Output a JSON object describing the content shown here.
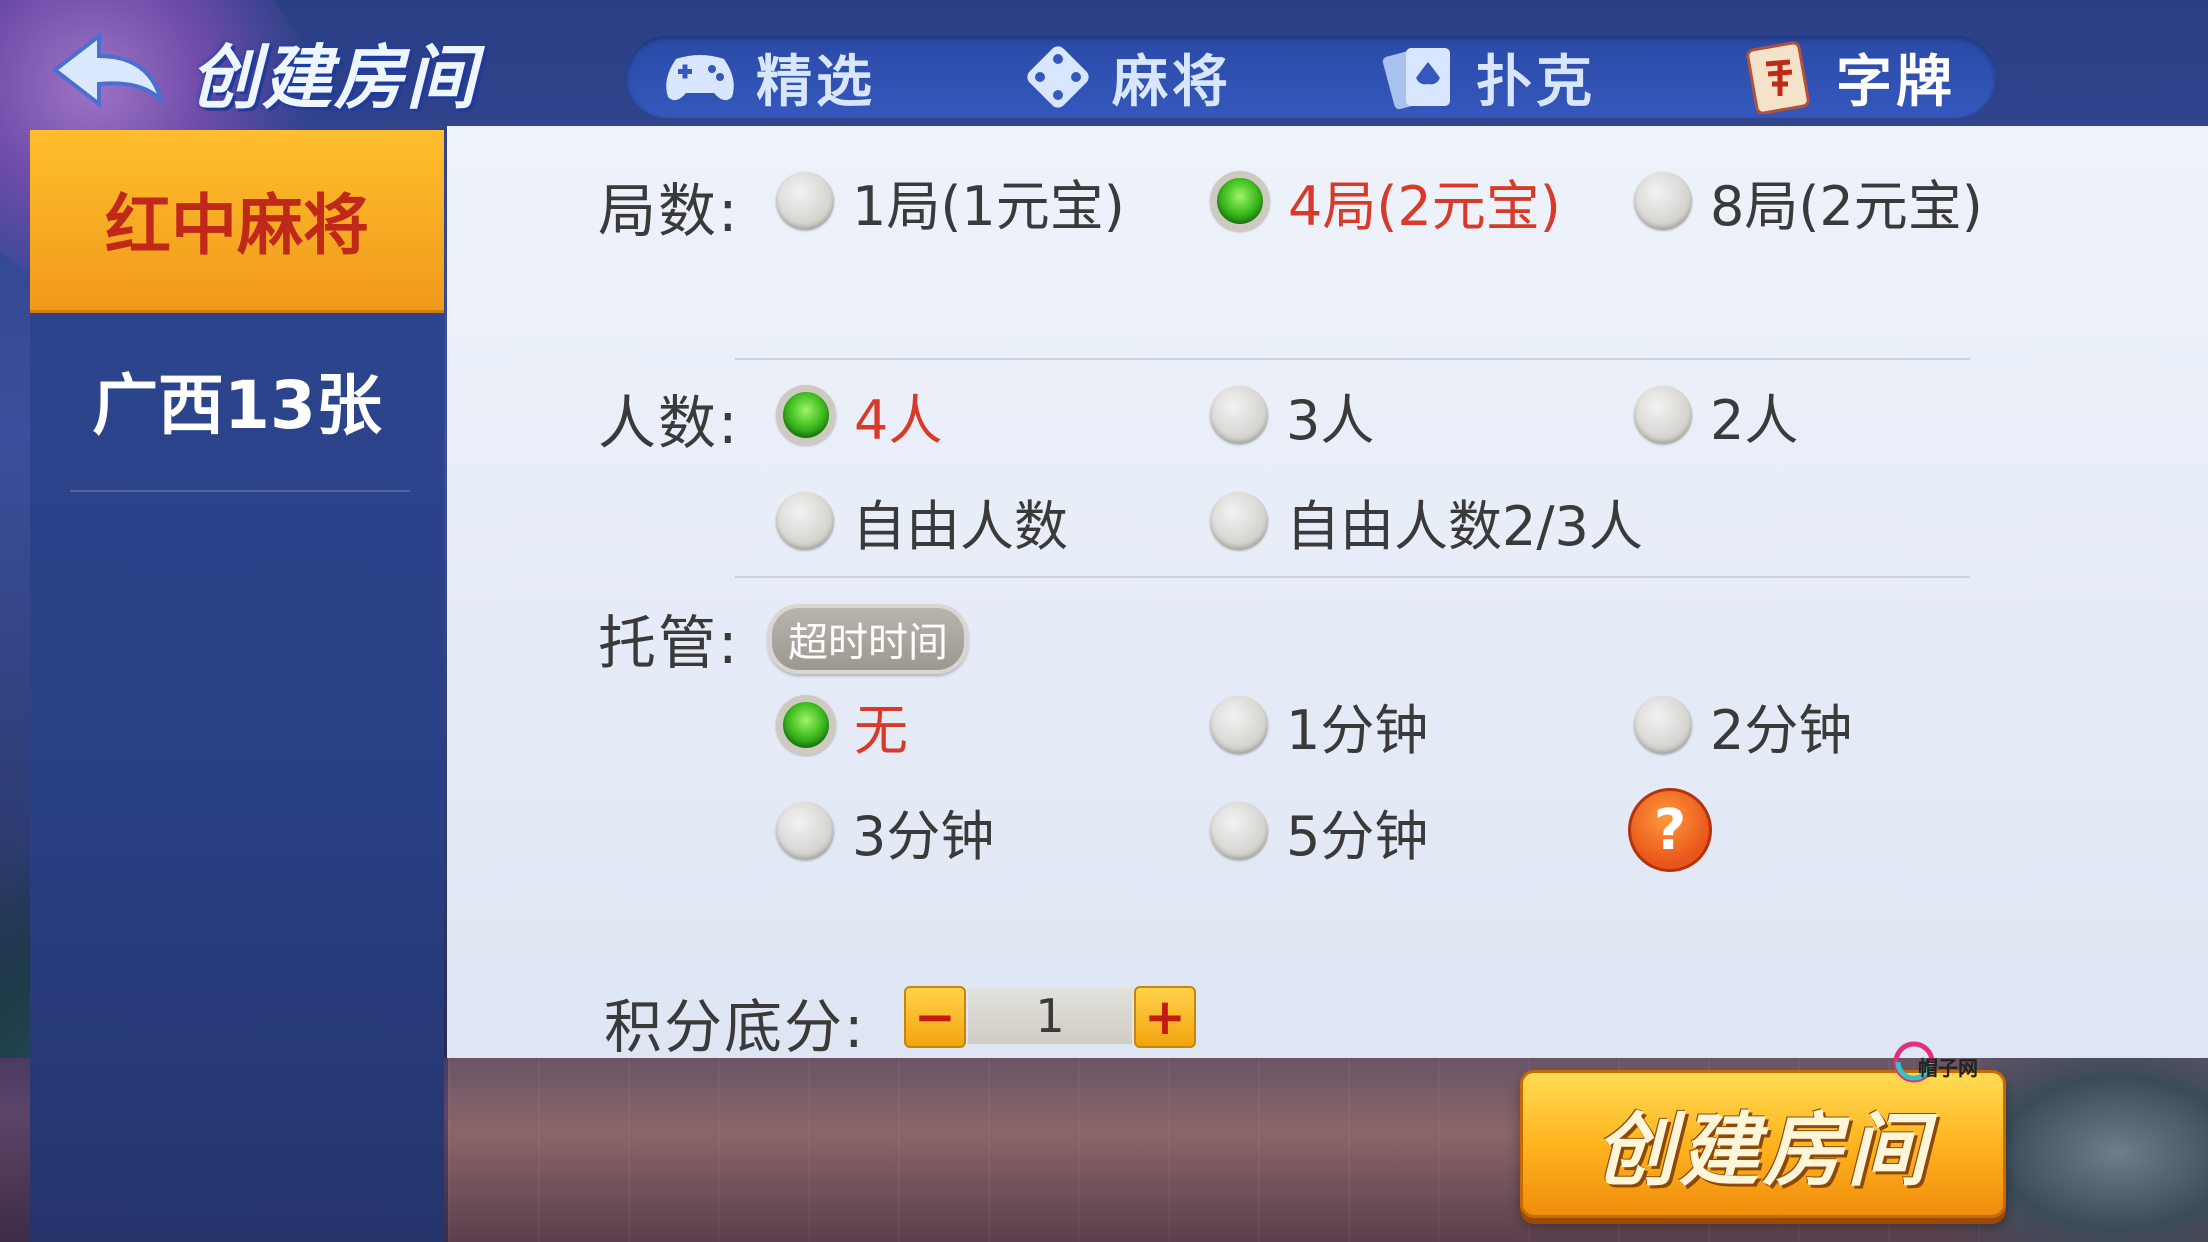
{
  "header": {
    "title": "创建房间",
    "tabs": [
      {
        "label": "精选",
        "icon": "gamepad-icon"
      },
      {
        "label": "麻将",
        "icon": "dice-icon"
      },
      {
        "label": "扑克",
        "icon": "cards-icon"
      },
      {
        "label": "字牌",
        "icon": "zipai-card-icon"
      }
    ]
  },
  "sidebar": {
    "items": [
      {
        "label": "红中麻将",
        "active": true
      },
      {
        "label": "广西13张",
        "active": false
      }
    ]
  },
  "rounds": {
    "label": "局数:",
    "options": [
      {
        "label": "1局(1元宝)",
        "selected": false
      },
      {
        "label": "4局(2元宝)",
        "selected": true
      },
      {
        "label": "8局(2元宝)",
        "selected": false
      }
    ]
  },
  "players": {
    "label": "人数:",
    "options": [
      {
        "label": "4人",
        "selected": true
      },
      {
        "label": "3人",
        "selected": false
      },
      {
        "label": "2人",
        "selected": false
      },
      {
        "label": "自由人数",
        "selected": false
      },
      {
        "label": "自由人数2/3人",
        "selected": false
      }
    ]
  },
  "hosting": {
    "label": "托管:",
    "badge": "超时时间",
    "options": [
      {
        "label": "无",
        "selected": true
      },
      {
        "label": "1分钟",
        "selected": false
      },
      {
        "label": "2分钟",
        "selected": false
      },
      {
        "label": "3分钟",
        "selected": false
      },
      {
        "label": "5分钟",
        "selected": false
      }
    ],
    "help": "?"
  },
  "score": {
    "label": "积分底分:",
    "value": "1",
    "minus": "−",
    "plus": "+"
  },
  "create_button": {
    "label": "创建房间"
  },
  "watermark": "帽子网",
  "colors": {
    "accent": "#f5a623",
    "selected_text": "#d83a2a",
    "header_blue": "#2f4fae"
  }
}
